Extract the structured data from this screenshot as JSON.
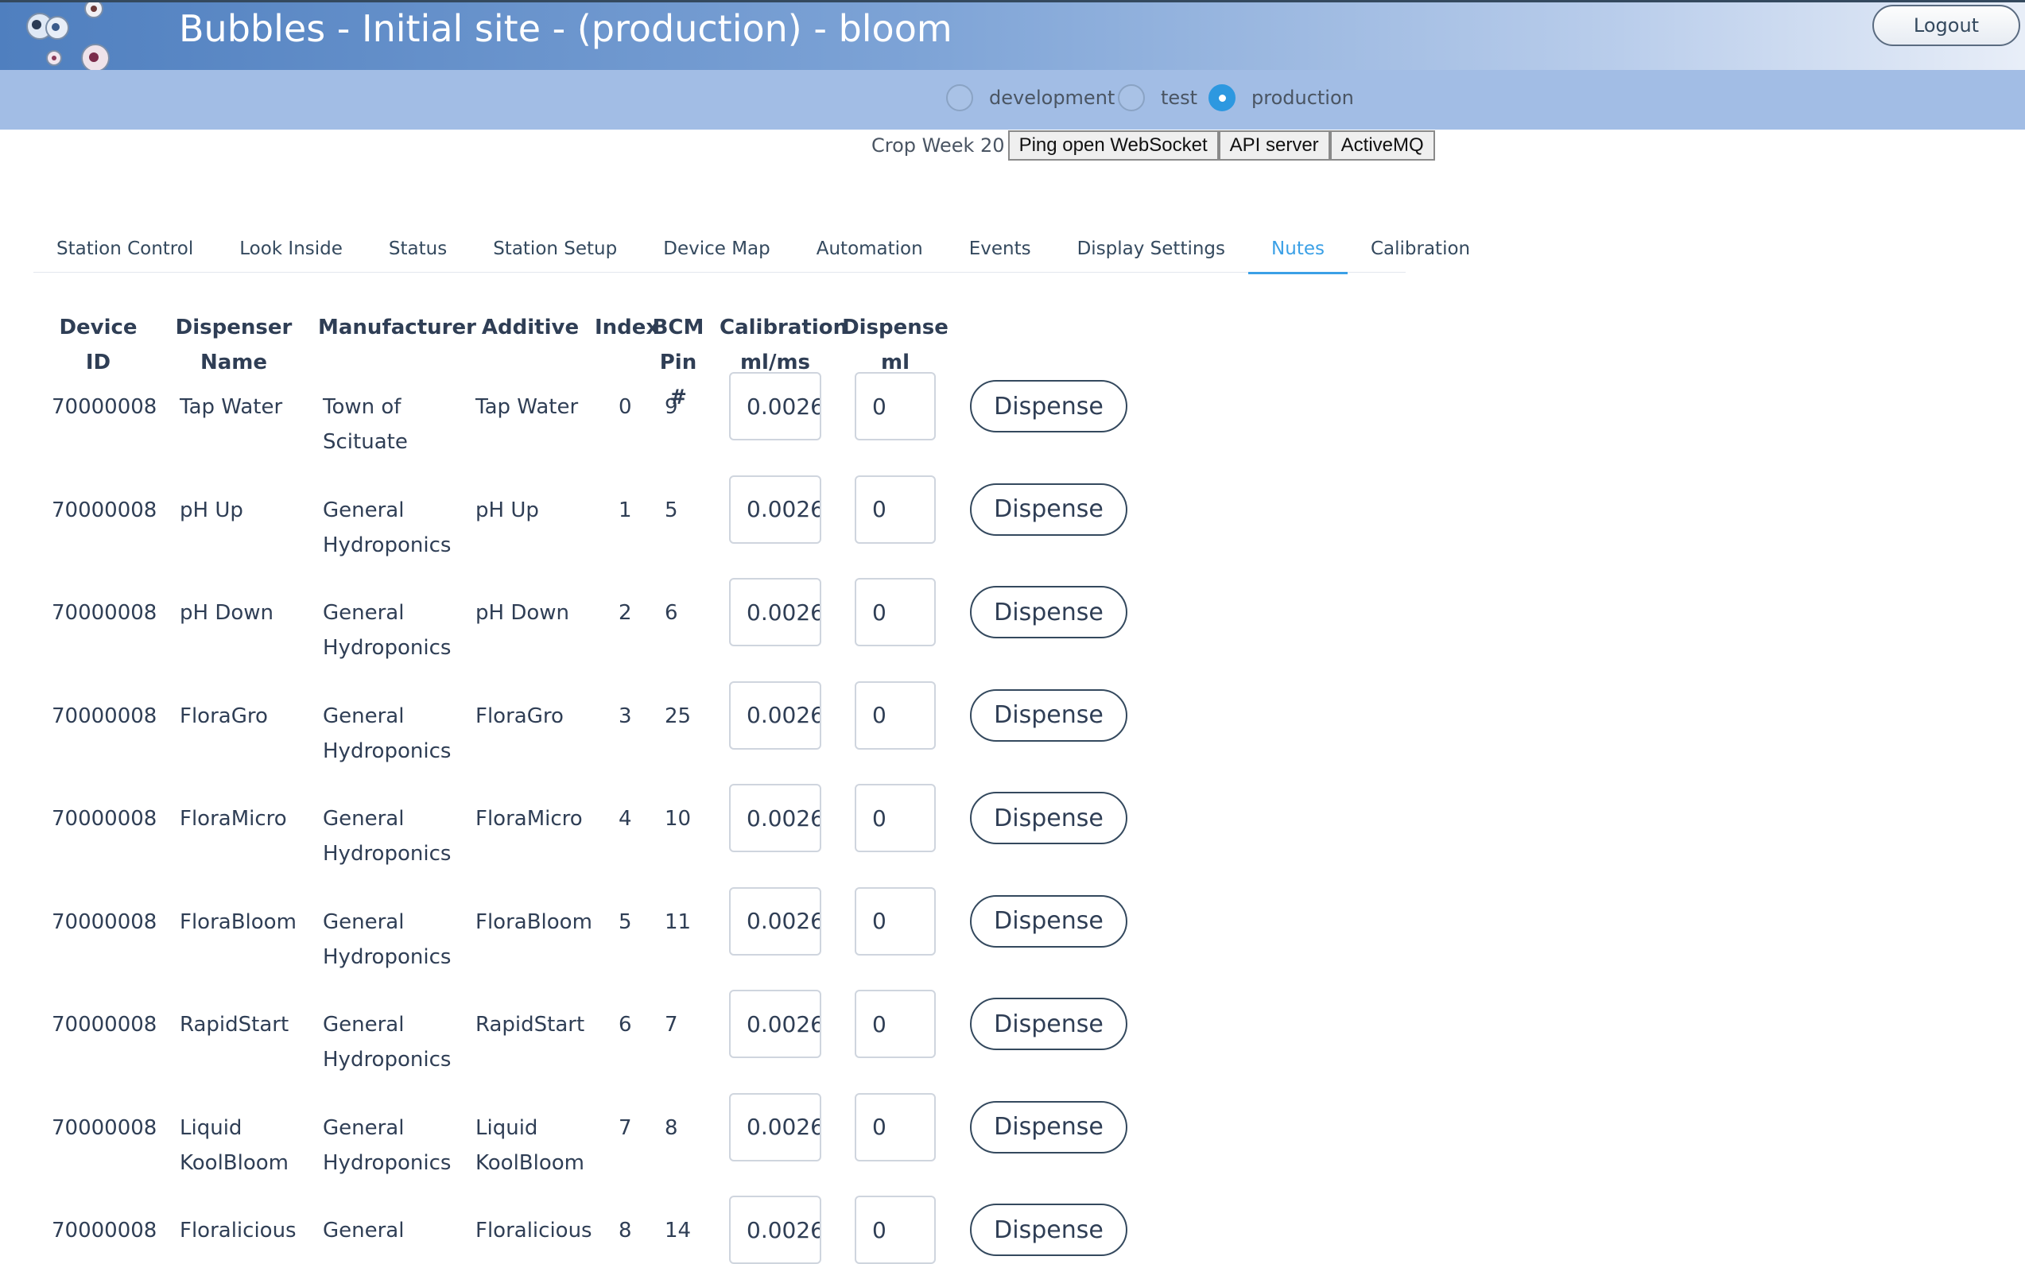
{
  "header": {
    "title": "Bubbles - Initial site - (production) - bloom",
    "logout_label": "Logout"
  },
  "environments": [
    {
      "label": "development",
      "selected": false
    },
    {
      "label": "test",
      "selected": false
    },
    {
      "label": "production",
      "selected": true
    }
  ],
  "toolbar": {
    "crop_week": "Crop Week 20",
    "ping_label": "Ping open WebSocket",
    "api_label": "API server",
    "mq_label": "ActiveMQ"
  },
  "tabs": [
    {
      "label": "Station Control",
      "active": false
    },
    {
      "label": "Look Inside",
      "active": false
    },
    {
      "label": "Status",
      "active": false
    },
    {
      "label": "Station Setup",
      "active": false
    },
    {
      "label": "Device Map",
      "active": false
    },
    {
      "label": "Automation",
      "active": false
    },
    {
      "label": "Events",
      "active": false
    },
    {
      "label": "Display Settings",
      "active": false
    },
    {
      "label": "Nutes",
      "active": true
    },
    {
      "label": "Calibration",
      "active": false
    }
  ],
  "table": {
    "headers": {
      "device_id": "Device ID",
      "dispenser_name": "Dispenser Name",
      "manufacturer": "Manufacturer",
      "additive": "Additive",
      "index": "Index",
      "bcm_pin": "BCM Pin #",
      "calibration": "Calibration ml/ms",
      "dispense_ml": "Dispense ml"
    },
    "dispense_label": "Dispense",
    "rows": [
      {
        "device_id": "70000008",
        "name": "Tap Water",
        "manufacturer": "Town of Scituate",
        "additive": "Tap Water",
        "index": "0",
        "pin": "9",
        "calibration": "0.0026",
        "dispense": "0"
      },
      {
        "device_id": "70000008",
        "name": "pH Up",
        "manufacturer": "General Hydroponics",
        "additive": "pH Up",
        "index": "1",
        "pin": "5",
        "calibration": "0.0026",
        "dispense": "0"
      },
      {
        "device_id": "70000008",
        "name": "pH Down",
        "manufacturer": "General Hydroponics",
        "additive": "pH Down",
        "index": "2",
        "pin": "6",
        "calibration": "0.0026",
        "dispense": "0"
      },
      {
        "device_id": "70000008",
        "name": "FloraGro",
        "manufacturer": "General Hydroponics",
        "additive": "FloraGro",
        "index": "3",
        "pin": "25",
        "calibration": "0.0026",
        "dispense": "0"
      },
      {
        "device_id": "70000008",
        "name": "FloraMicro",
        "manufacturer": "General Hydroponics",
        "additive": "FloraMicro",
        "index": "4",
        "pin": "10",
        "calibration": "0.0026",
        "dispense": "0"
      },
      {
        "device_id": "70000008",
        "name": "FloraBloom",
        "manufacturer": "General Hydroponics",
        "additive": "FloraBloom",
        "index": "5",
        "pin": "11",
        "calibration": "0.0026",
        "dispense": "0"
      },
      {
        "device_id": "70000008",
        "name": "RapidStart",
        "manufacturer": "General Hydroponics",
        "additive": "RapidStart",
        "index": "6",
        "pin": "7",
        "calibration": "0.0026",
        "dispense": "0"
      },
      {
        "device_id": "70000008",
        "name": "Liquid KoolBloom",
        "manufacturer": "General Hydroponics",
        "additive": "Liquid KoolBloom",
        "index": "7",
        "pin": "8",
        "calibration": "0.0026",
        "dispense": "0"
      },
      {
        "device_id": "70000008",
        "name": "Floralicious",
        "manufacturer": "General",
        "additive": "Floralicious",
        "index": "8",
        "pin": "14",
        "calibration": "0.0026",
        "dispense": "0"
      }
    ]
  }
}
